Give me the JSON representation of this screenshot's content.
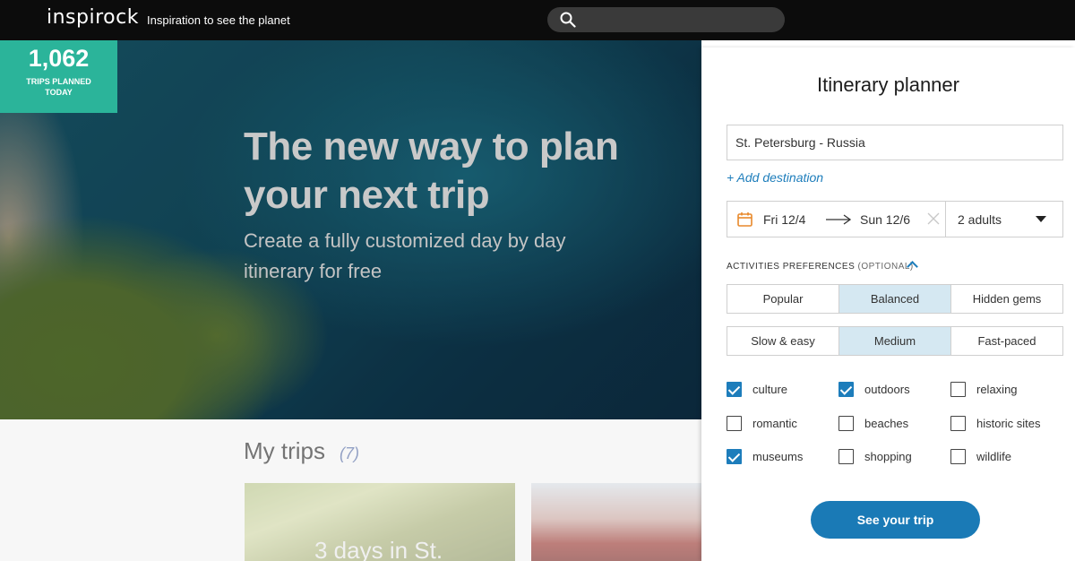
{
  "header": {
    "logo": "inspirock",
    "tagline": "Inspiration to see the planet",
    "search_placeholder": ""
  },
  "counter": {
    "number": "1,062",
    "label": "TRIPS PLANNED TODAY"
  },
  "hero": {
    "title": "The new way to plan your next trip",
    "subtitle": "Create a fully customized day by day itinerary for free"
  },
  "my_trips": {
    "title": "My trips",
    "count": "(7)",
    "cards": [
      {
        "title": "3 days in St."
      },
      {
        "title": ""
      }
    ]
  },
  "planner": {
    "title": "Itinerary planner",
    "destination": "St. Petersburg - Russia",
    "add_destination": "+ Add destination",
    "date_from": "Fri 12/4",
    "date_to": "Sun 12/6",
    "travelers": "2 adults",
    "prefs_label": "ACTIVITIES PREFERENCES",
    "prefs_optional": "(OPTIONAL)",
    "style_options": [
      "Popular",
      "Balanced",
      "Hidden gems"
    ],
    "style_selected": "Balanced",
    "pace_options": [
      "Slow & easy",
      "Medium",
      "Fast-paced"
    ],
    "pace_selected": "Medium",
    "interests": [
      {
        "label": "culture",
        "checked": true
      },
      {
        "label": "outdoors",
        "checked": true
      },
      {
        "label": "relaxing",
        "checked": false
      },
      {
        "label": "romantic",
        "checked": false
      },
      {
        "label": "beaches",
        "checked": false
      },
      {
        "label": "historic sites",
        "checked": false
      },
      {
        "label": "museums",
        "checked": true
      },
      {
        "label": "shopping",
        "checked": false
      },
      {
        "label": "wildlife",
        "checked": false
      }
    ],
    "submit": "See your trip"
  },
  "colors": {
    "accent_blue": "#1a7ab6",
    "counter_green": "#2bb49a",
    "segment_active": "#d5e8f2"
  }
}
